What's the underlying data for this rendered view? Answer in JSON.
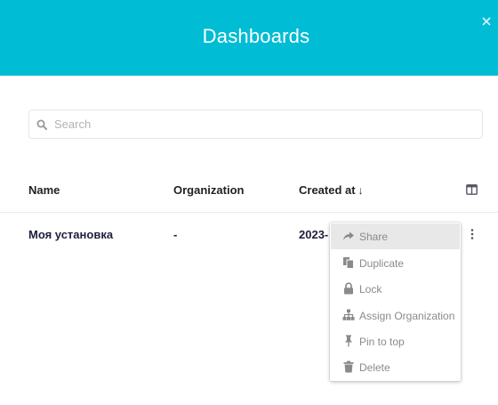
{
  "header": {
    "title": "Dashboards"
  },
  "search": {
    "placeholder": "Search",
    "value": ""
  },
  "table": {
    "columns": {
      "name": "Name",
      "organization": "Organization",
      "created_at": "Created at",
      "sort_indicator": "↓"
    },
    "rows": [
      {
        "name": "Моя установка",
        "organization": "-",
        "created_at": "2023-"
      }
    ]
  },
  "context_menu": {
    "items": [
      {
        "label": "Share",
        "icon": "share-icon"
      },
      {
        "label": "Duplicate",
        "icon": "duplicate-icon"
      },
      {
        "label": "Lock",
        "icon": "lock-icon"
      },
      {
        "label": "Assign Organization",
        "icon": "sitemap-icon"
      },
      {
        "label": "Pin to top",
        "icon": "pin-icon"
      },
      {
        "label": "Delete",
        "icon": "trash-icon"
      }
    ]
  },
  "colors": {
    "header_bg": "#00bcd4",
    "menu_text": "#8a8a8a",
    "menu_icon": "#8a8a8a",
    "row_text": "#1e1e3c",
    "menu_active_bg": "#e8e8e8"
  }
}
